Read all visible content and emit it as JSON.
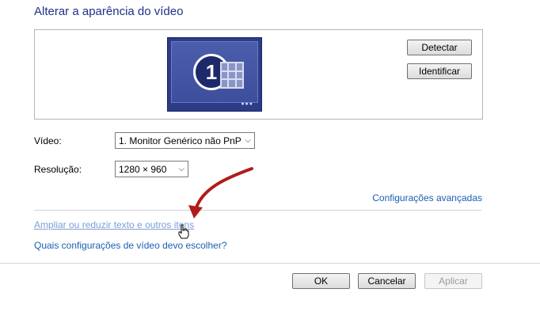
{
  "title": "Alterar a aparência do vídeo",
  "monitor": {
    "number": "1",
    "icon": "monitor-icon"
  },
  "buttons": {
    "detect": "Detectar",
    "identify": "Identificar",
    "ok": "OK",
    "cancel": "Cancelar",
    "apply": "Aplicar"
  },
  "fields": {
    "video_label": "Vídeo:",
    "video_value": "1. Monitor Genérico não PnP",
    "resolution_label": "Resolução:",
    "resolution_value": "1280 × 960"
  },
  "links": {
    "advanced": "Configurações avançadas",
    "text_size": "Ampliar ou reduzir texto e outros itens",
    "which_settings": "Quais configurações de vídeo devo escolher?"
  },
  "annotation": {
    "arrow_color": "#b01c1c",
    "cursor": "hand-cursor-icon"
  }
}
